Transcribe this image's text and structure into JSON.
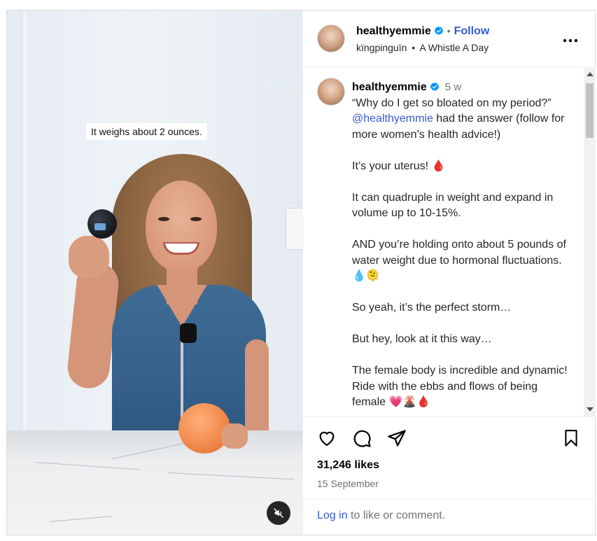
{
  "media": {
    "caption": "It weighs about 2 ounces.",
    "mute_icon": "speaker-muted-icon"
  },
  "header": {
    "username": "healthyemmie",
    "separator": "•",
    "follow_label": "Follow",
    "audio_artist": "kïngpinguïn",
    "audio_separator": "•",
    "audio_title": "A Whistle A Day",
    "more_icon": "more-options-icon"
  },
  "comment": {
    "username": "healthyemmie",
    "time": "5 w",
    "text_part1": "“Why do I get so bloated on my period?” ",
    "mention": "@healthyemmie",
    "text_part2": " had the answer (follow for more women’s health advice!)\n\nIt’s your uterus! 🩸\n\nIt can quadruple in weight and expand in volume up to 10-15%.\n\nAND you’re holding onto about 5 pounds of water weight due to hormonal fluctuations. 💧🫠\n\nSo yeah, it’s the perfect storm…\n\nBut hey, look at it this way…\n\nThe female body is incredible and dynamic! Ride with the ebbs and flows of being female 💗🌋🩸"
  },
  "actions": {
    "like_icon": "heart-icon",
    "comment_icon": "comment-icon",
    "share_icon": "share-icon",
    "save_icon": "bookmark-icon",
    "likes": "31,246 likes",
    "date": "15 September"
  },
  "login": {
    "link_label": "Log in",
    "rest_text": " to like or comment."
  },
  "colors": {
    "link_blue": "#385bd1",
    "verified_blue": "#0095f6",
    "muted_text": "#737373"
  }
}
